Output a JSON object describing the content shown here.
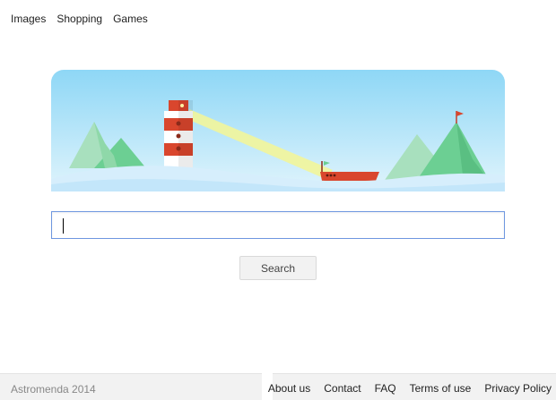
{
  "top_nav": {
    "images_label": "Images",
    "shopping_label": "Shopping",
    "games_label": "Games"
  },
  "banner": {
    "sky_color_top": "#9fdcf7",
    "sky_color_bottom": "#d8f1fb",
    "water_color": "#cdeafb",
    "mountain_light": "#a8e0be",
    "mountain_dark": "#6ccf93",
    "lighthouse_red": "#d9462d",
    "beam_color": "#f2f59a",
    "boat_color": "#d9462d",
    "flag_color": "#6ccf93"
  },
  "search": {
    "value": "",
    "placeholder": "",
    "button_label": "Search",
    "border_color": "#6f97e0"
  },
  "footer": {
    "copyright": "Astromenda 2014",
    "links": [
      "About us",
      "Contact",
      "FAQ",
      "Terms of use",
      "Privacy Policy"
    ]
  }
}
